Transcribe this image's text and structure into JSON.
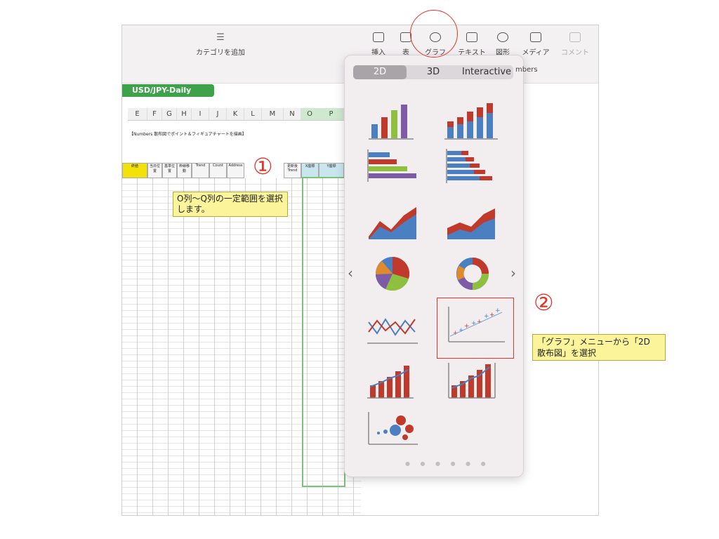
{
  "toolbar": {
    "category_label": "カテゴリを追加",
    "insert": "挿入",
    "table": "表",
    "chart": "グラフ",
    "text": "テキスト",
    "shape": "図形",
    "media": "メディア",
    "comment": "コメント"
  },
  "sheet_tab": "USD/JPY-Daily",
  "sheet_title": "【Numbers 散布図でポイント＆フィギュアチャートを描画】",
  "columns": [
    "E",
    "F",
    "G",
    "H",
    "I",
    "J",
    "K",
    "L",
    "M",
    "N",
    "O",
    "P"
  ],
  "headers": [
    "終値",
    "当日位置",
    "基準位置",
    "枠線移動",
    "Trend",
    "Count",
    "Address",
    "",
    "",
    "更新後Trend",
    "X座標",
    "Y座標"
  ],
  "annotations": {
    "step1_number": "①",
    "step1_note": "O列〜Q列の一定範囲を選択します。",
    "step2_number": "②",
    "step2_note": "「グラフ」メニューから「2D 散布図」を選択"
  },
  "chart_picker": {
    "tabs": [
      "2D",
      "3D",
      "Interactive"
    ],
    "active_tab": "2D",
    "partial_label": "mbers",
    "prev_arrow": "‹",
    "next_arrow": "›",
    "page_dots": "● ● ● ● ● ●"
  },
  "colors": {
    "accent_red": "#e0352b",
    "note_yellow": "#fbf49a",
    "sheet_green": "#3ea24a",
    "bar_blue": "#4a7fc1",
    "bar_red": "#c0392b",
    "bar_green": "#8fbf3f",
    "bar_purple": "#7d5ba6"
  }
}
